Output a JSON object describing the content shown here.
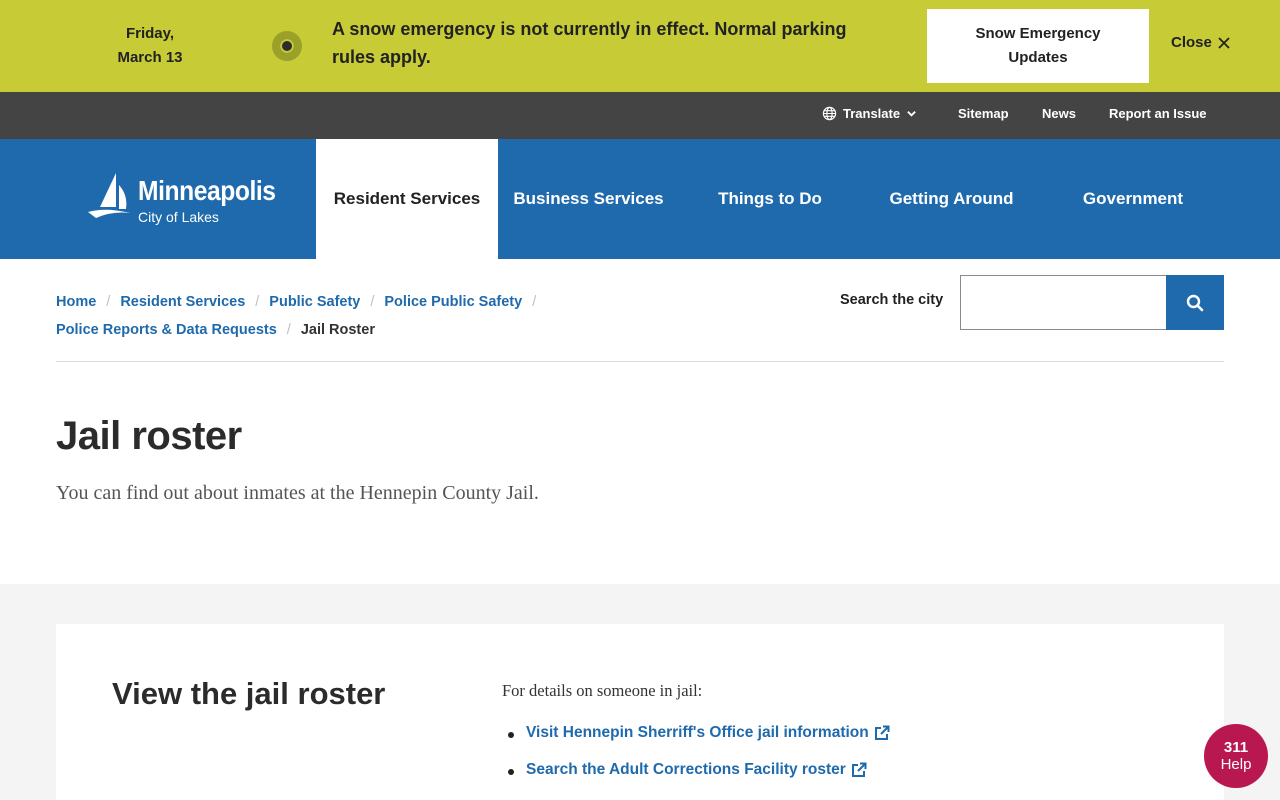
{
  "alert": {
    "date_line1": "Friday,",
    "date_line2": "March 13",
    "message": "A snow emergency is not currently in effect. Normal parking rules apply.",
    "button_label": "Snow Emergency Updates",
    "close_label": "Close"
  },
  "utility": {
    "translate": "Translate",
    "sitemap": "Sitemap",
    "news": "News",
    "report": "Report an Issue"
  },
  "logo": {
    "name": "Minneapolis",
    "tagline": "City of Lakes"
  },
  "nav": {
    "items": [
      {
        "label": "Resident Services",
        "active": true
      },
      {
        "label": "Business Services"
      },
      {
        "label": "Things to Do"
      },
      {
        "label": "Getting Around"
      },
      {
        "label": "Government"
      }
    ]
  },
  "breadcrumb": {
    "items": [
      "Home",
      "Resident Services",
      "Public Safety",
      "Police Public Safety",
      "Police Reports & Data Requests"
    ],
    "current": "Jail Roster"
  },
  "search": {
    "label": "Search the city",
    "placeholder": ""
  },
  "page": {
    "title": "Jail roster",
    "lede": "You can find out about inmates at the Hennepin County Jail."
  },
  "card": {
    "title": "View the jail roster",
    "intro": "For details on someone in jail:",
    "links": [
      "Visit Hennepin Sherriff's Office jail information",
      "Search the Adult Corrections Facility roster"
    ]
  },
  "help": {
    "number": "311",
    "label": "Help"
  },
  "colors": {
    "alert_bg": "#c6cb36",
    "utility_bg": "#444444",
    "brand_blue": "#1f6aad",
    "help_bg": "#b8174f"
  }
}
